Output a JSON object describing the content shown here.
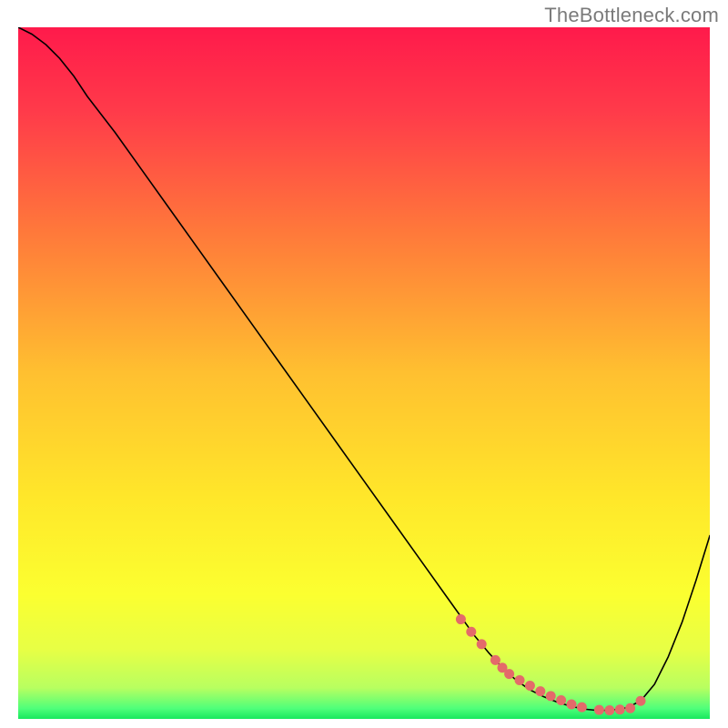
{
  "watermark": "TheBottleneck.com",
  "chart_data": {
    "type": "line",
    "title": "",
    "xlabel": "",
    "ylabel": "",
    "xlim": [
      0,
      100
    ],
    "ylim": [
      0,
      100
    ],
    "grid": false,
    "legend": false,
    "background": {
      "type": "vertical-gradient",
      "stops": [
        {
          "offset": 0.0,
          "color": "#ff1a4b"
        },
        {
          "offset": 0.12,
          "color": "#ff3a4a"
        },
        {
          "offset": 0.3,
          "color": "#ff7a3a"
        },
        {
          "offset": 0.5,
          "color": "#ffc030"
        },
        {
          "offset": 0.68,
          "color": "#ffe72a"
        },
        {
          "offset": 0.82,
          "color": "#fbff30"
        },
        {
          "offset": 0.9,
          "color": "#e7ff45"
        },
        {
          "offset": 0.955,
          "color": "#b8ff60"
        },
        {
          "offset": 0.985,
          "color": "#4fff7a"
        },
        {
          "offset": 1.0,
          "color": "#18e85e"
        }
      ]
    },
    "series": [
      {
        "name": "bottleneck-curve",
        "stroke": "#000000",
        "strokeWidth": 1.6,
        "x": [
          0,
          2,
          4,
          6,
          8,
          10,
          14,
          18,
          22,
          26,
          30,
          34,
          38,
          42,
          46,
          50,
          54,
          58,
          62,
          66,
          68,
          70,
          72,
          74,
          76,
          78,
          80,
          82,
          84,
          86,
          88,
          90,
          92,
          94,
          96,
          98,
          100
        ],
        "y": [
          100,
          99,
          97.5,
          95.5,
          93,
          90,
          84.8,
          79.2,
          73.6,
          68.0,
          62.4,
          56.8,
          51.2,
          45.6,
          40.0,
          34.4,
          28.8,
          23.2,
          17.6,
          12.0,
          9.6,
          7.4,
          5.6,
          4.2,
          3.2,
          2.4,
          1.8,
          1.4,
          1.2,
          1.3,
          1.6,
          2.6,
          5.0,
          9.0,
          14.0,
          20.0,
          26.5
        ]
      },
      {
        "name": "optimal-range-markers",
        "type": "scatter",
        "stroke": "#e46a6a",
        "fill": "#e46a6a",
        "radius": 5.5,
        "x": [
          64,
          65.5,
          67,
          69,
          70,
          71,
          72.5,
          74,
          75.5,
          77,
          78.5,
          80,
          81.5,
          84,
          85.5,
          87,
          88.5,
          90
        ],
        "y": [
          14.4,
          12.6,
          10.8,
          8.5,
          7.4,
          6.5,
          5.6,
          4.8,
          4.0,
          3.3,
          2.7,
          2.1,
          1.7,
          1.3,
          1.25,
          1.35,
          1.55,
          2.6
        ]
      }
    ]
  }
}
